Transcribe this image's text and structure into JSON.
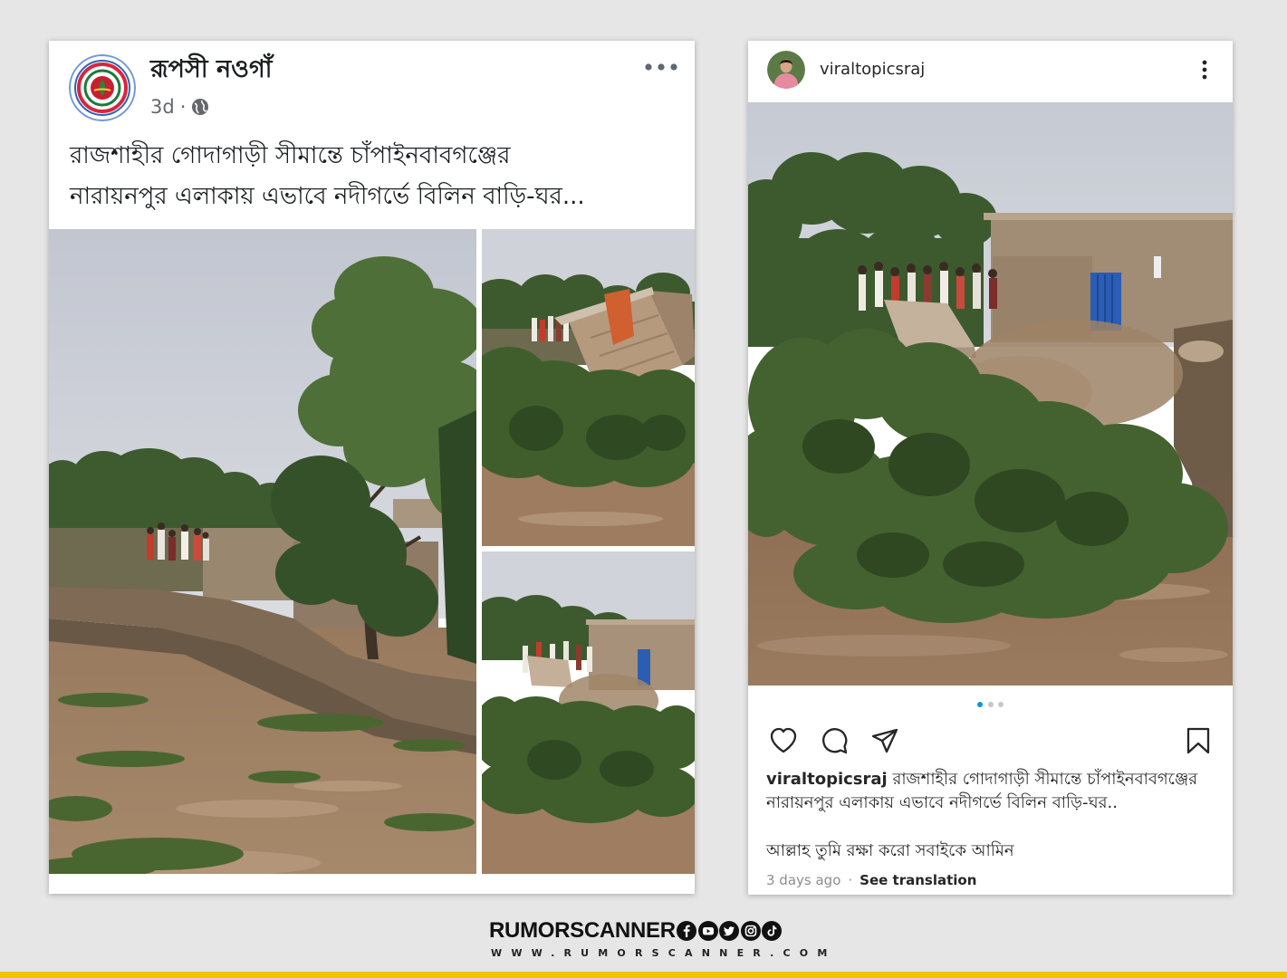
{
  "facebook_post": {
    "page_name": "রূপসী নওগাঁ",
    "time": "3d",
    "separator": "·",
    "audience_icon": "globe-icon",
    "more_icon": "more-horizontal-icon",
    "text_lines": [
      "রাজশাহীর গোদাগাড়ী সীমান্তে চাঁপাইনবাবগঞ্জের",
      "নারায়নপুর এলাকায় এভাবে নদীগর্ভে বিলিন বাড়ি-ঘর..."
    ]
  },
  "instagram_post": {
    "username": "viraltopicsraj",
    "more_icon": "more-vertical-icon",
    "carousel": {
      "total": 3,
      "active": 1
    },
    "actions": [
      "heart-icon",
      "comment-icon",
      "send-icon",
      "bookmark-icon"
    ],
    "caption": {
      "username": "viraltopicsraj",
      "lines": [
        "রাজশাহীর গোদাগাড়ী সীমান্তে চাঁপাইনবাবগঞ্জের",
        "নারায়নপুর এলাকায় এভাবে নদীগর্ভে বিলিন বাড়ি-ঘর.."
      ]
    },
    "comment": "আল্লাহ তুমি রক্ষা করো সবাইকে আমিন",
    "time": "3 days ago",
    "separator": "·",
    "see_translation": "See translation"
  },
  "watermark": {
    "brand": "RUMORSCANNER",
    "url": "WWW.RUMORSCANNER.COM",
    "social_icons": [
      "facebook-icon",
      "youtube-icon",
      "twitter-icon",
      "instagram-icon",
      "tiktok-icon"
    ]
  },
  "colors": {
    "page_background": "#e6e6e6",
    "facebook_text": "#1c1e21",
    "facebook_meta": "#65676b",
    "instagram_text": "#262626",
    "instagram_meta": "#8e8e8e",
    "carousel_active": "#0095f6",
    "carousel_inactive": "#c7c7c7",
    "accent_bar": "#f3c300"
  }
}
